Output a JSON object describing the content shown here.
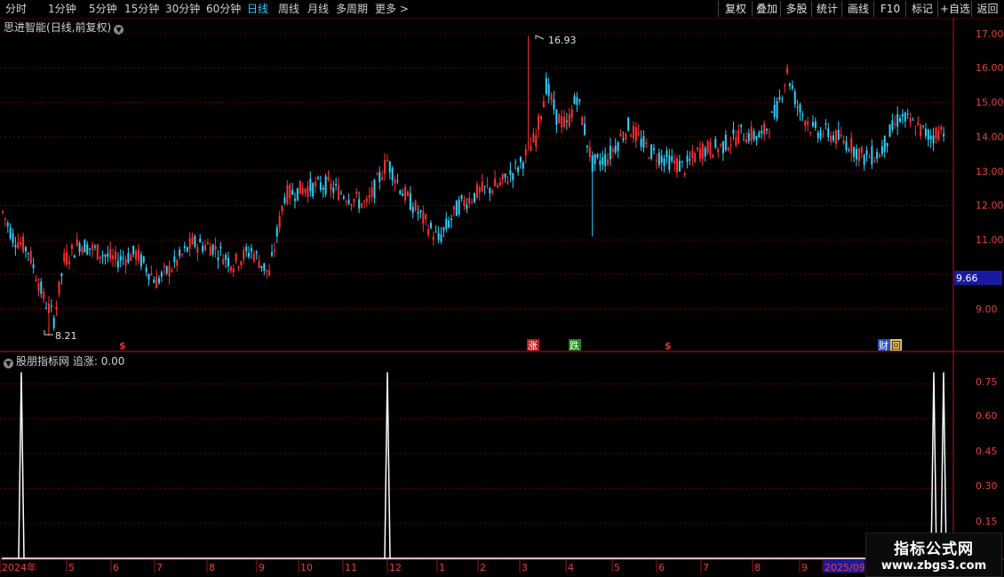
{
  "toolbar": {
    "periods": [
      "分时",
      "1分钟",
      "5分钟",
      "15分钟",
      "30分钟",
      "60分钟",
      "日线",
      "周线",
      "月线",
      "多周期",
      "更多"
    ],
    "more_arrow": ">",
    "buttons": [
      "复权",
      "叠加",
      "多股",
      "统计",
      "画线",
      "F10",
      "标记",
      "+自选",
      "返回"
    ]
  },
  "main_panel": {
    "stock_name": "思进智能",
    "mode": "(日线,前复权)",
    "high_label": "16.93",
    "low_label": "8.21",
    "current_price": "9.66",
    "price_axis": [
      "17.00",
      "16.00",
      "15.00",
      "14.00",
      "13.00",
      "12.00",
      "11.00",
      "9.00"
    ],
    "event_markers": [
      {
        "text": "$",
        "color": "#e03030"
      },
      {
        "text": "涨",
        "color": "#ffffff",
        "bg": "#c01818"
      },
      {
        "text": "跌",
        "color": "#ffffff",
        "bg": "#188818"
      },
      {
        "text": "$",
        "color": "#e03030"
      },
      {
        "text": "财",
        "color": "#ffffff",
        "bg": "#2050c0"
      },
      {
        "text": "回",
        "color": "#202020",
        "bg": "#e8c060"
      }
    ]
  },
  "indicator_panel": {
    "name": "股朋指标网",
    "series_label": "追涨:",
    "series_value": "0.00",
    "axis": [
      "0.75",
      "0.60",
      "0.45",
      "0.30",
      "0.15"
    ]
  },
  "date_axis": [
    "2024年",
    "5",
    "6",
    "7",
    "8",
    "9",
    "10",
    "11",
    "12",
    "1",
    "2",
    "3",
    "4",
    "5",
    "6",
    "7",
    "8",
    "9",
    "2025/09"
  ],
  "watermark": {
    "line1": "指标公式网",
    "line2": "www.zbgs3.com"
  },
  "colors": {
    "up": "#ff3030",
    "down": "#30d0ff",
    "grid": "#7a0000",
    "axis": "#c01010",
    "highlight": "#1a1aa0"
  },
  "chart_data": [
    {
      "type": "candlestick",
      "title": "思进智能(日线,前复权)",
      "y_ticks": [
        9,
        10,
        11,
        12,
        13,
        14,
        15,
        16,
        17
      ],
      "ylim": [
        8,
        17.3
      ],
      "x_labels": [
        "2024年",
        "5",
        "6",
        "7",
        "8",
        "9",
        "10",
        "11",
        "12",
        "1",
        "2",
        "3",
        "4",
        "5",
        "6",
        "7",
        "8",
        "9",
        "2025/09"
      ],
      "high": 16.93,
      "low": 8.21,
      "last": 9.66,
      "trend": [
        [
          0,
          11.8
        ],
        [
          4,
          11.1
        ],
        [
          10,
          10.7
        ],
        [
          16,
          9.3
        ],
        [
          20,
          8.7
        ],
        [
          24,
          10.4
        ],
        [
          30,
          10.9
        ],
        [
          36,
          10.7
        ],
        [
          44,
          10.4
        ],
        [
          52,
          10.6
        ],
        [
          60,
          9.8
        ],
        [
          66,
          10.2
        ],
        [
          74,
          10.9
        ],
        [
          82,
          10.8
        ],
        [
          90,
          10.3
        ],
        [
          97,
          10.7
        ],
        [
          104,
          10.0
        ],
        [
          110,
          12.3
        ],
        [
          118,
          12.5
        ],
        [
          126,
          12.6
        ],
        [
          134,
          12.3
        ],
        [
          142,
          12.0
        ],
        [
          150,
          13.3
        ],
        [
          156,
          12.4
        ],
        [
          164,
          11.6
        ],
        [
          170,
          11.0
        ],
        [
          178,
          12.0
        ],
        [
          186,
          12.4
        ],
        [
          194,
          12.6
        ],
        [
          202,
          13.2
        ],
        [
          208,
          14.0
        ],
        [
          212,
          15.5
        ],
        [
          216,
          14.6
        ],
        [
          220,
          14.3
        ],
        [
          224,
          15.2
        ],
        [
          230,
          13.2
        ],
        [
          236,
          13.4
        ],
        [
          244,
          14.3
        ],
        [
          252,
          13.6
        ],
        [
          260,
          13.3
        ],
        [
          266,
          13.1
        ],
        [
          272,
          13.6
        ],
        [
          280,
          13.7
        ],
        [
          288,
          14.1
        ],
        [
          296,
          14.0
        ],
        [
          302,
          14.8
        ],
        [
          306,
          15.9
        ],
        [
          310,
          14.9
        ],
        [
          316,
          14.2
        ],
        [
          322,
          14.1
        ],
        [
          330,
          13.8
        ],
        [
          336,
          13.4
        ],
        [
          342,
          13.5
        ],
        [
          346,
          14.1
        ],
        [
          350,
          14.6
        ],
        [
          356,
          14.3
        ],
        [
          362,
          14.0
        ],
        [
          368,
          14.3
        ]
      ]
    },
    {
      "type": "line",
      "title": "股朋指标网",
      "series": [
        {
          "name": "追涨",
          "values": [
            0,
            1,
            0,
            1,
            0,
            1,
            1,
            0
          ]
        }
      ],
      "x": [
        0,
        1,
        2,
        3,
        4,
        5,
        6,
        7
      ],
      "y_ticks": [
        0.15,
        0.3,
        0.45,
        0.6,
        0.75
      ],
      "ylim": [
        0,
        0.82
      ]
    }
  ]
}
